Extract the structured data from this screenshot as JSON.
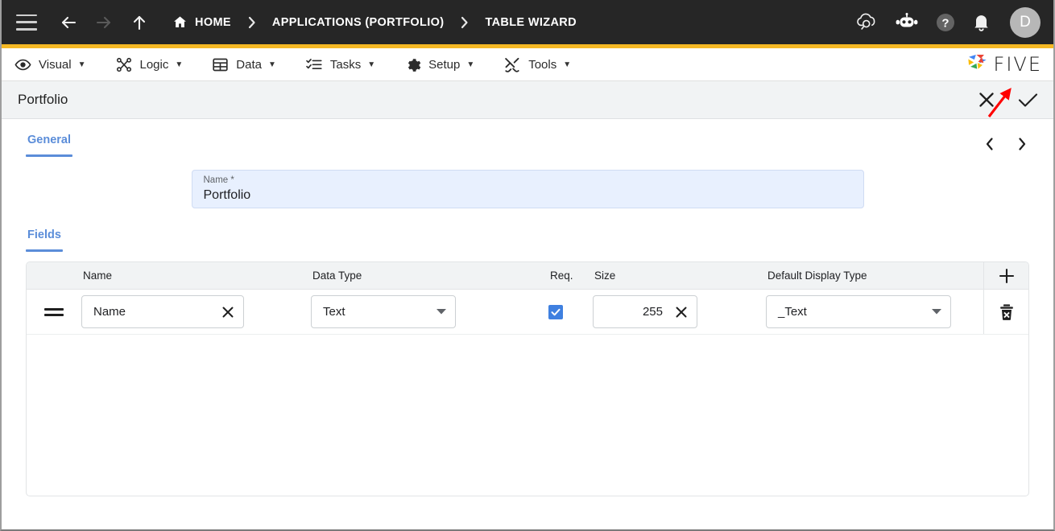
{
  "header": {
    "menu_icon": "hamburger-icon",
    "back_icon": "arrow-left-icon",
    "forward_icon": "arrow-right-icon",
    "up_icon": "arrow-up-icon",
    "breadcrumbs": [
      {
        "label": "HOME",
        "icon": "home-icon"
      },
      {
        "label": "APPLICATIONS (PORTFOLIO)",
        "icon": ""
      },
      {
        "label": "TABLE WIZARD",
        "icon": ""
      }
    ],
    "separator": "›",
    "actions": [
      {
        "name": "cloud-search-icon"
      },
      {
        "name": "robot-icon"
      },
      {
        "name": "help-icon"
      },
      {
        "name": "notifications-bell-icon"
      }
    ],
    "avatar_initial": "D",
    "accent_bar_color": "#f5b824"
  },
  "menubar": {
    "items": [
      {
        "label": "Visual",
        "icon": "eye-icon",
        "caret": "▼"
      },
      {
        "label": "Logic",
        "icon": "logic-nodes-icon",
        "caret": "▼"
      },
      {
        "label": "Data",
        "icon": "table-grid-icon",
        "caret": "▼"
      },
      {
        "label": "Tasks",
        "icon": "checklist-icon",
        "caret": "▼"
      },
      {
        "label": "Setup",
        "icon": "gear-icon",
        "caret": "▼"
      },
      {
        "label": "Tools",
        "icon": "tools-icon",
        "caret": "▼"
      }
    ],
    "brand": "FIVE"
  },
  "form": {
    "title": "Portfolio",
    "cancel_icon": "close-icon",
    "save_icon": "check-icon"
  },
  "general": {
    "tab_label": "General",
    "prev_icon": "chevron-left-icon",
    "next_icon": "chevron-right-icon",
    "name_field": {
      "label": "Name *",
      "value": "Portfolio",
      "placeholder": "Name"
    }
  },
  "fields": {
    "tab_label": "Fields",
    "columns": [
      "",
      "Name",
      "Data Type",
      "Req.",
      "Size",
      "Default Display Type"
    ],
    "add_icon": "plus-icon",
    "rows": [
      {
        "handle_icon": "drag-handle-icon",
        "name": "Name",
        "name_clear_icon": "clear-icon",
        "data_type": "Text",
        "required": true,
        "size": "255",
        "size_clear_icon": "clear-icon",
        "default_display_type": "_Text",
        "delete_icon": "trash-icon"
      }
    ]
  },
  "annotation": {
    "arrow_color": "#ff0000",
    "points_at": "save-button"
  },
  "colors": {
    "accent_blue": "#5b8dd9",
    "checkbox_blue": "#3f80e0",
    "field_highlight": "#e8f0fe",
    "header_dark": "#262626"
  }
}
